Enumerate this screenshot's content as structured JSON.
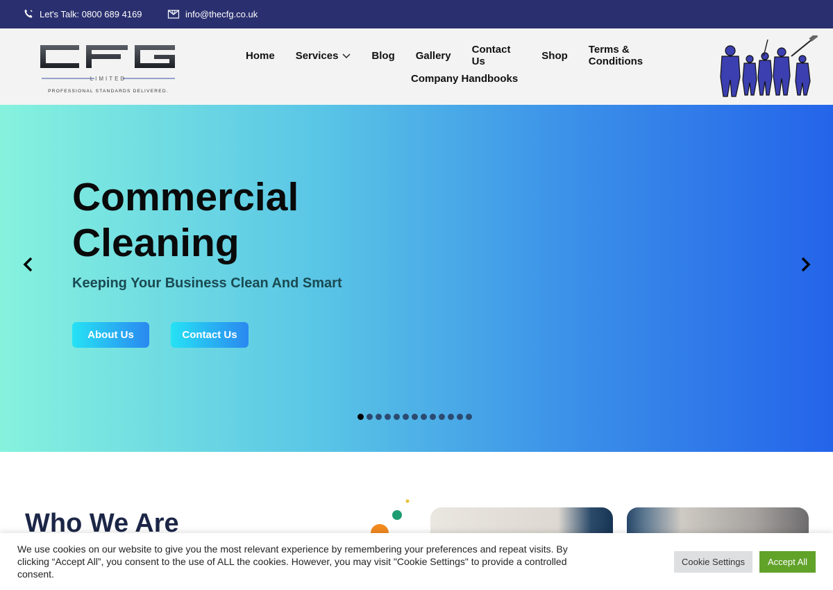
{
  "topbar": {
    "phone_text": "Let's Talk: 0800 689 4169",
    "email_text": "info@thecfg.co.uk",
    "background": "#2a2f6f"
  },
  "header": {
    "logo": {
      "text": "CFG",
      "sub": "LIMITED",
      "tagline": "PROFESSIONAL STANDARDS DELIVERED."
    },
    "nav": [
      {
        "label": "Home"
      },
      {
        "label": "Services",
        "has_dropdown": true
      },
      {
        "label": "Blog"
      },
      {
        "label": "Gallery"
      },
      {
        "label": "Contact Us"
      },
      {
        "label": "Shop"
      },
      {
        "label": "Terms & Conditions"
      },
      {
        "label": "Company Handbooks"
      }
    ]
  },
  "hero": {
    "title": "Commercial Cleaning",
    "subtitle": "Keeping Your Business Clean And Smart",
    "buttons": {
      "about": "About Us",
      "contact": "Contact Us"
    },
    "slide_count": 13,
    "active_slide": 1
  },
  "main": {
    "section_title": "Who We Are"
  },
  "cookie": {
    "message": "We use cookies on our website to give you the most relevant experience by remembering your preferences and repeat visits. By clicking “Accept All”, you consent to the use of ALL the cookies. However, you may visit \"Cookie Settings\" to provide a controlled consent.",
    "settings_label": "Cookie Settings",
    "accept_label": "Accept All",
    "accept_color": "#61a229"
  }
}
